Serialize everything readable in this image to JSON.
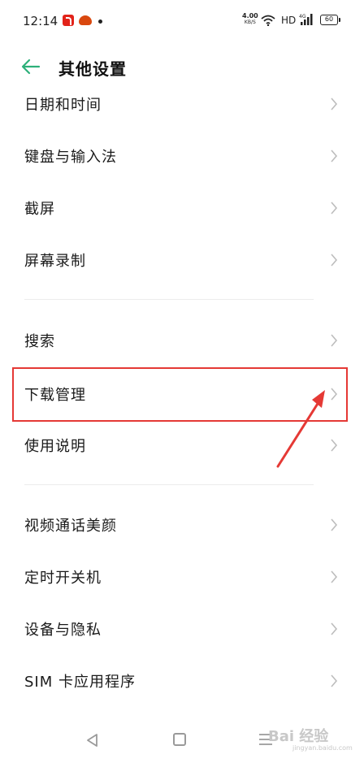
{
  "status_bar": {
    "time": "12:14",
    "net_speed": "4.00",
    "net_speed_unit": "KB/S",
    "hd": "HD",
    "signal_label": "4G",
    "battery": "60",
    "icons": [
      "tiktok-icon",
      "taobao-icon",
      "notification-dot",
      "wifi-icon",
      "signal-icon",
      "battery-icon"
    ]
  },
  "header": {
    "title": "其他设置",
    "back_icon": "arrow-left-icon",
    "accent_color": "#2db07a"
  },
  "items": [
    {
      "label": "日期和时间"
    },
    {
      "label": "键盘与输入法"
    },
    {
      "label": "截屏"
    },
    {
      "label": "屏幕录制"
    },
    {
      "label": "搜索"
    },
    {
      "label": "下载管理"
    },
    {
      "label": "使用说明"
    },
    {
      "label": "视频通话美颜"
    },
    {
      "label": "定时开关机"
    },
    {
      "label": "设备与隐私"
    },
    {
      "label": "SIM 卡应用程序"
    }
  ],
  "annotation": {
    "highlight_color": "#e53935"
  },
  "nav_bar": {
    "watermark": "Bai 经验",
    "watermark_url": "jingyan.baidu.com"
  }
}
